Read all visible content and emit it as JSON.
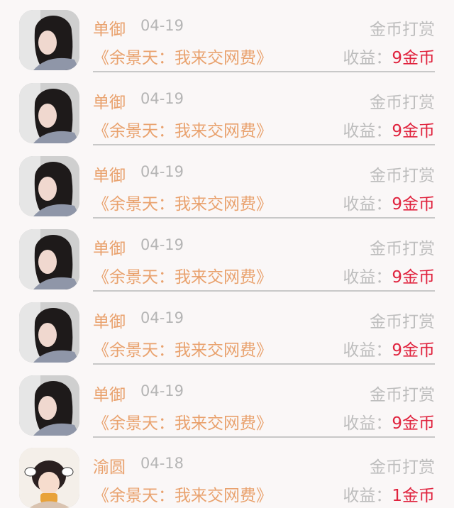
{
  "list": {
    "items": [
      {
        "name": "单御",
        "date": "04-19",
        "type": "金币打赏",
        "book": "《余景天：我来交网费》",
        "earn_label": "收益：",
        "earn_value": "9金币",
        "avatar": "girl-dark-hair"
      },
      {
        "name": "单御",
        "date": "04-19",
        "type": "金币打赏",
        "book": "《余景天：我来交网费》",
        "earn_label": "收益：",
        "earn_value": "9金币",
        "avatar": "girl-dark-hair"
      },
      {
        "name": "单御",
        "date": "04-19",
        "type": "金币打赏",
        "book": "《余景天：我来交网费》",
        "earn_label": "收益：",
        "earn_value": "9金币",
        "avatar": "girl-dark-hair"
      },
      {
        "name": "单御",
        "date": "04-19",
        "type": "金币打赏",
        "book": "《余景天：我来交网费》",
        "earn_label": "收益：",
        "earn_value": "9金币",
        "avatar": "girl-dark-hair"
      },
      {
        "name": "单御",
        "date": "04-19",
        "type": "金币打赏",
        "book": "《余景天：我来交网费》",
        "earn_label": "收益：",
        "earn_value": "9金币",
        "avatar": "girl-dark-hair"
      },
      {
        "name": "单御",
        "date": "04-19",
        "type": "金币打赏",
        "book": "《余景天：我来交网费》",
        "earn_label": "收益：",
        "earn_value": "9金币",
        "avatar": "girl-dark-hair"
      },
      {
        "name": "渝圆",
        "date": "04-18",
        "type": "金币打赏",
        "book": "《余景天：我来交网费》",
        "earn_label": "收益：",
        "earn_value": "1金币",
        "avatar": "child-cartoon"
      }
    ]
  },
  "colors": {
    "accent": "#e9a26e",
    "muted": "#bdbdbd",
    "value": "#e0233e",
    "background": "#faf7f7"
  }
}
